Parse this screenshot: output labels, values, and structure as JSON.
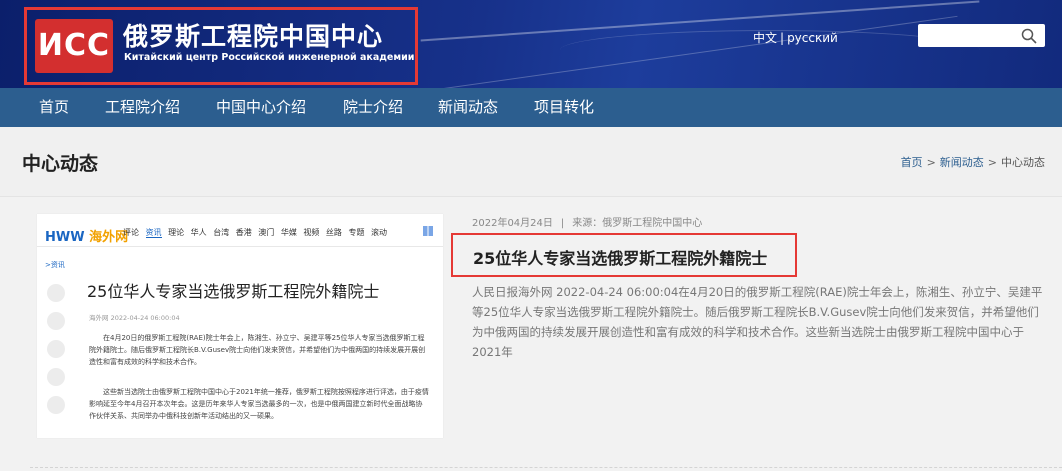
{
  "header": {
    "logo_mark": "ИCC",
    "logo_title_cn": "俄罗斯工程院中国中心",
    "logo_title_ru": "Китайский центр Российской инженерной академии",
    "lang_cn": "中文",
    "lang_sep": "|",
    "lang_ru": "русский",
    "search_value": "",
    "search_icon": "search-icon",
    "accent_color": "#e53935"
  },
  "nav": {
    "items": [
      "首页",
      "工程院介绍",
      "中国中心介绍",
      "院士介绍",
      "新闻动态",
      "项目转化"
    ]
  },
  "page": {
    "title": "中心动态",
    "breadcrumb": [
      "首页",
      "新闻动态",
      "中心动态"
    ],
    "breadcrumb_sep": ">"
  },
  "news": {
    "date": "2022年04月24日",
    "source": "来源：俄罗斯工程院中国中心",
    "meta_sep": "|",
    "title": "25位华人专家当选俄罗斯工程院外籍院士",
    "summary": "人民日报海外网 2022-04-24 06:00:04在4月20日的俄罗斯工程院(RAE)院士年会上，陈湘生、孙立宁、吴建平等25位华人专家当选俄罗斯工程院外籍院士。随后俄罗斯工程院长B.V.Gusev院士向他们发来贺信，并希望他们为中俄两国的持续发展开展创造性和富有成效的科学和技术合作。这些新当选院士由俄罗斯工程院中国中心于2021年",
    "thumbnail": {
      "site_logo": "HWW",
      "site_logo_cn": "海外网",
      "nav": [
        "评论",
        "资讯",
        "理论",
        "华人",
        "台湾",
        "香港",
        "澳门",
        "华媒",
        "视频",
        "丝路",
        "专题",
        "滚动"
      ],
      "nav_current": "资讯",
      "tag": ">资讯",
      "title": "25位华人专家当选俄罗斯工程院外籍院士",
      "meta": "海外网 2022-04-24 06:00:04",
      "para1": "在4月20日的俄罗斯工程院(RAE)院士年会上，陈湘生、孙立宁、吴建平等25位华人专家当选俄罗斯工程院外籍院士。随后俄罗斯工程院长B.V.Gusev院士向他们发来贺信，并希望他们为中俄两国的持续发展开展创造性和富有成效的科学和技术合作。",
      "para2": "这些新当选院士由俄罗斯工程院中国中心于2021年统一推荐，俄罗斯工程院按照程序进行评选，由于疫情影响延至今年4月召开本次年会。这是历年来华人专家当选最多的一次，也是中俄两国建立新时代全面战略协作伙伴关系、共同举办中俄科技创新年活动结出的又一硕果。"
    }
  }
}
